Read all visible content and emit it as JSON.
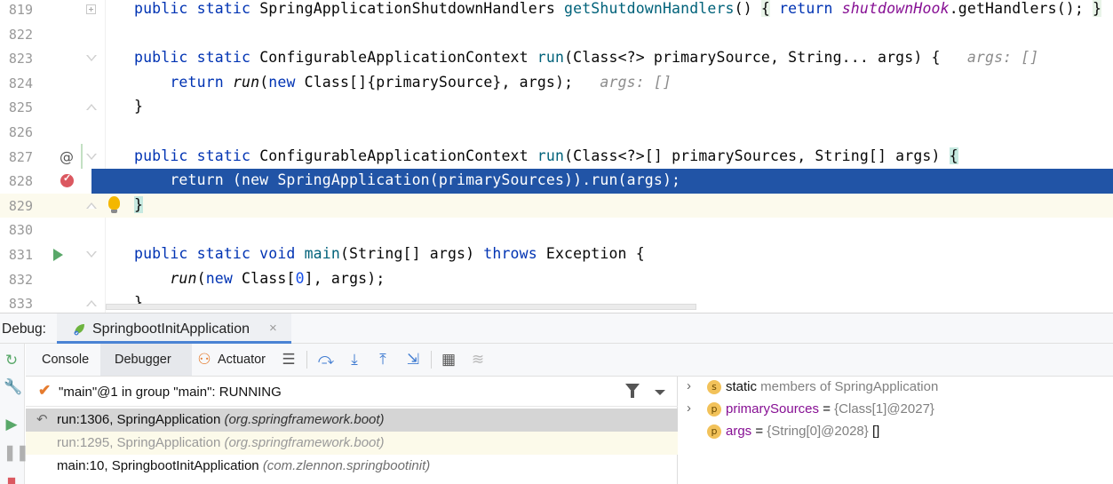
{
  "editor": {
    "lines": [
      {
        "num": "819",
        "code": [
          [
            "public static ",
            "kw"
          ],
          [
            "SpringApplicationShutdownHandlers ",
            ""
          ],
          [
            "getShutdownHandlers",
            "fn"
          ],
          [
            "() ",
            ""
          ],
          [
            "{",
            "fold-bg"
          ],
          [
            " ",
            ""
          ],
          [
            "return ",
            "kw"
          ],
          [
            "shutdownHook",
            "st"
          ],
          [
            ".getHandlers(); ",
            ""
          ],
          [
            "}",
            "fold-bg"
          ]
        ]
      },
      {
        "num": "822",
        "code": []
      },
      {
        "num": "823",
        "code": [
          [
            "public static ",
            "kw"
          ],
          [
            "ConfigurableApplicationContext ",
            ""
          ],
          [
            "run",
            "fn"
          ],
          [
            "(Class<?> primarySource, String... args) {   ",
            ""
          ],
          [
            "args: []",
            "hint"
          ]
        ]
      },
      {
        "num": "824",
        "code": [
          [
            "    return ",
            "kw"
          ],
          [
            "run",
            "it"
          ],
          [
            "(",
            ""
          ],
          [
            "new ",
            "kw"
          ],
          [
            "Class[]{primarySource}, args);   ",
            ""
          ],
          [
            "args: []",
            "hint"
          ]
        ]
      },
      {
        "num": "825",
        "code": [
          [
            "}",
            ""
          ]
        ]
      },
      {
        "num": "826",
        "code": []
      },
      {
        "num": "827",
        "code": [
          [
            "public static ",
            "kw"
          ],
          [
            "ConfigurableApplicationContext ",
            ""
          ],
          [
            "run",
            "fn"
          ],
          [
            "(Class<?>[] primarySources, String[] args) ",
            ""
          ],
          [
            "{",
            "brace-hl"
          ]
        ]
      },
      {
        "num": "828",
        "code": [
          [
            "    return (new SpringApplication(primarySources)).run(args);",
            ""
          ]
        ]
      },
      {
        "num": "829",
        "code": [
          [
            "}",
            "brace-hl"
          ]
        ]
      },
      {
        "num": "830",
        "code": []
      },
      {
        "num": "831",
        "code": [
          [
            "public static void ",
            "kw"
          ],
          [
            "main",
            "fn"
          ],
          [
            "(String[] args) ",
            ""
          ],
          [
            "throws ",
            "kw"
          ],
          [
            "Exception {",
            ""
          ]
        ]
      },
      {
        "num": "832",
        "code": [
          [
            "    ",
            ""
          ],
          [
            "run",
            "it"
          ],
          [
            "(",
            ""
          ],
          [
            "new ",
            "kw"
          ],
          [
            "Class[",
            ""
          ],
          [
            "0",
            "num"
          ],
          [
            "], args);",
            ""
          ]
        ]
      },
      {
        "num": "833",
        "code": [
          [
            "}",
            ""
          ]
        ]
      }
    ]
  },
  "debug": {
    "label": "Debug:",
    "session_tab": "SpringbootInitApplication",
    "close_glyph": "×"
  },
  "toolbar": {
    "console": "Console",
    "debugger": "Debugger",
    "actuator": "Actuator"
  },
  "frames": {
    "thread": "\"main\"@1 in group \"main\": RUNNING",
    "items": [
      {
        "method": "run:1306, SpringApplication ",
        "pkg": "(org.springframework.boot)"
      },
      {
        "method": "run:1295, SpringApplication ",
        "pkg": "(org.springframework.boot)"
      },
      {
        "method": "main:10, SpringbootInitApplication ",
        "pkg": "(com.zlennon.springbootinit)"
      }
    ]
  },
  "variables": {
    "items": [
      {
        "badge": "s",
        "prefix": "static",
        "name": "",
        "rest": " members of SpringApplication",
        "expandable": true
      },
      {
        "badge": "p",
        "prefix": "",
        "name": "primarySources",
        "rest": " = ",
        "ref": "{Class[1]@2027}",
        "expandable": true
      },
      {
        "badge": "p",
        "prefix": "",
        "name": "args",
        "rest": " = ",
        "ref": "{String[0]@2028}",
        "tail": " []",
        "expandable": false
      }
    ]
  }
}
